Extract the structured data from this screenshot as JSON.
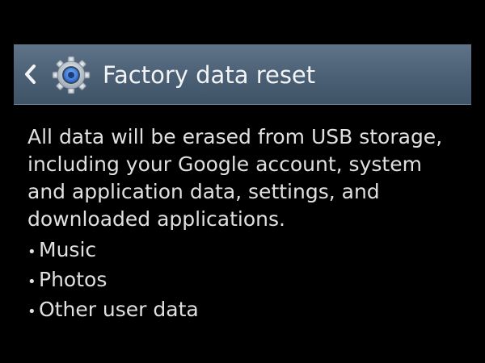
{
  "header": {
    "title": "Factory data reset",
    "back_icon": "chevron-left-icon",
    "app_icon": "gear-icon",
    "background_color": "#4e6378"
  },
  "main": {
    "description": "All data will be erased from USB storage, including your Google account, system and application data, settings, and downloaded applications.",
    "items": [
      {
        "label": "Music"
      },
      {
        "label": "Photos"
      },
      {
        "label": "Other user data"
      }
    ]
  }
}
